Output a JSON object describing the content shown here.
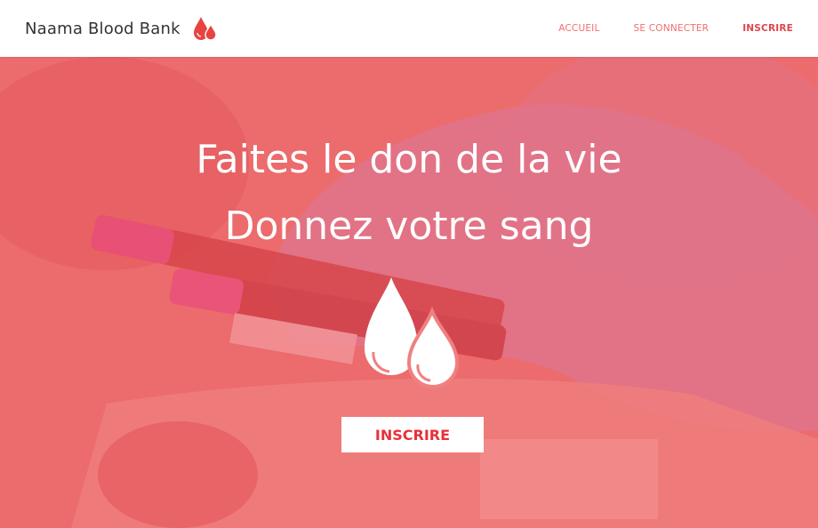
{
  "brand": {
    "name": "Naama Blood Bank",
    "logo_icon": "blood-drops-icon"
  },
  "nav": {
    "links": [
      {
        "label": "ACCUEIL",
        "active": false
      },
      {
        "label": "SE CONNECTER",
        "active": false
      },
      {
        "label": "INSCRIRE",
        "active": true
      }
    ]
  },
  "hero": {
    "title_line1": "Faites le don de la vie",
    "title_line2": "Donnez votre sang",
    "icon": "blood-drops-icon",
    "cta_label": "INSCRIRE"
  },
  "colors": {
    "accent": "#e8303a",
    "nav_link": "#f26d6d",
    "overlay": "#f05050"
  }
}
